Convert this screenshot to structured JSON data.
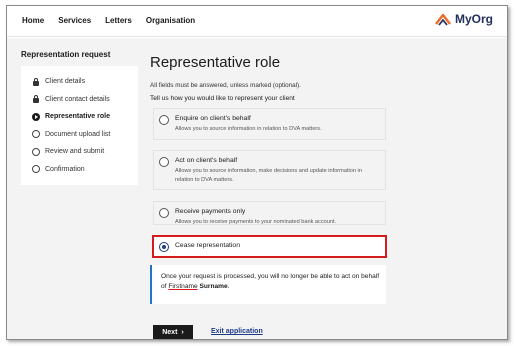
{
  "header": {
    "nav": [
      "Home",
      "Services",
      "Letters",
      "Organisation"
    ],
    "brand": "MyOrg"
  },
  "sidebar": {
    "title": "Representation request",
    "items": [
      {
        "label": "Client details",
        "icon": "lock-icon"
      },
      {
        "label": "Client contact details",
        "icon": "lock-icon"
      },
      {
        "label": "Representative role",
        "icon": "current-step-arrow-icon",
        "active": true
      },
      {
        "label": "Document upload list",
        "icon": "circle-icon"
      },
      {
        "label": "Review and submit",
        "icon": "circle-icon"
      },
      {
        "label": "Confirmation",
        "icon": "circle-icon"
      }
    ]
  },
  "main": {
    "title": "Representative role",
    "hint": "All fields must be answered, unless marked (optional).",
    "lead": "Tell us how you would like to represent your client",
    "options": [
      {
        "label": "Enquire on client's behalf",
        "desc": "Allows you to source information in relation to DVA matters.",
        "selected": false
      },
      {
        "label": "Act on client's behalf",
        "desc": "Allows you to source information, make decisions and update information in relation to DVA matters.",
        "selected": false
      },
      {
        "label": "Receive payments only",
        "desc": "Allows you to receive payments to your nominated bank account.",
        "selected": false
      },
      {
        "label": "Cease representation",
        "desc": "",
        "selected": true
      }
    ],
    "notice": {
      "text_before": "Once your request is processed, you will no longer be able to act on behalf of ",
      "name_first": "Firstname",
      "name_last": "Surname",
      "text_after": "."
    },
    "next_label": "Next",
    "exit_label": "Exit application"
  },
  "colors": {
    "accent": "#1f3c88",
    "highlight_border": "#d51b1b",
    "notice_border": "#1f75c9",
    "background": "#f3f3f3"
  }
}
